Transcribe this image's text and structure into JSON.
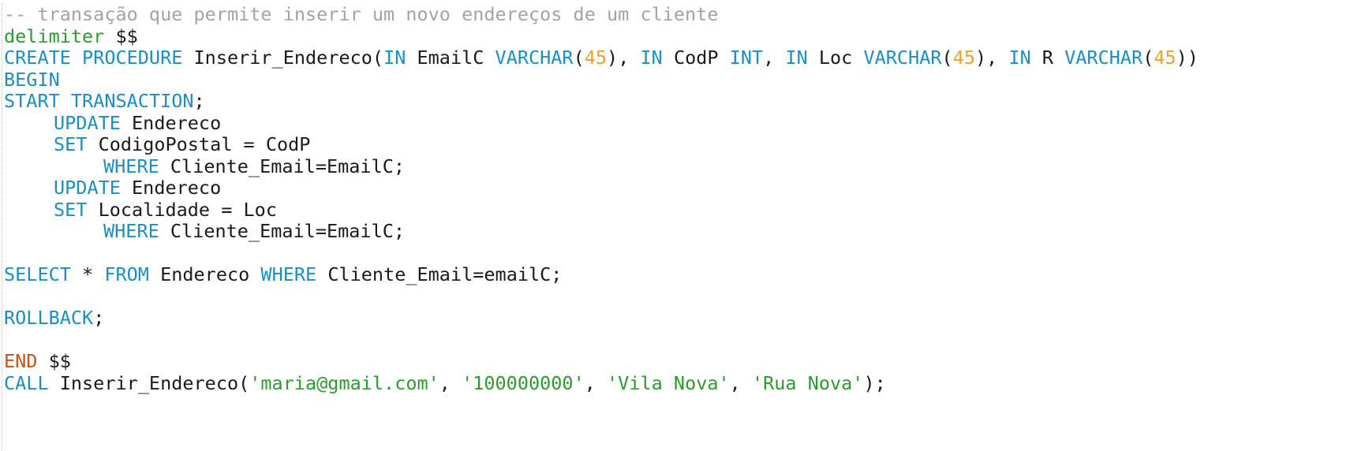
{
  "editor": {
    "lines": [
      [
        {
          "t": "-- transação que permite inserir um novo endereços de um cliente",
          "c": "comment"
        }
      ],
      [
        {
          "t": "delimiter",
          "c": "delim"
        },
        {
          "t": " $$",
          "c": "plain"
        }
      ],
      [
        {
          "t": "CREATE",
          "c": "kw"
        },
        {
          "t": " ",
          "c": "plain"
        },
        {
          "t": "PROCEDURE",
          "c": "kw"
        },
        {
          "t": " Inserir_Endereco(",
          "c": "plain"
        },
        {
          "t": "IN",
          "c": "kw"
        },
        {
          "t": " EmailC ",
          "c": "plain"
        },
        {
          "t": "VARCHAR",
          "c": "kw"
        },
        {
          "t": "(",
          "c": "plain"
        },
        {
          "t": "45",
          "c": "num"
        },
        {
          "t": "), ",
          "c": "plain"
        },
        {
          "t": "IN",
          "c": "kw"
        },
        {
          "t": " CodP ",
          "c": "plain"
        },
        {
          "t": "INT",
          "c": "kw"
        },
        {
          "t": ", ",
          "c": "plain"
        },
        {
          "t": "IN",
          "c": "kw"
        },
        {
          "t": " Loc ",
          "c": "plain"
        },
        {
          "t": "VARCHAR",
          "c": "kw"
        },
        {
          "t": "(",
          "c": "plain"
        },
        {
          "t": "45",
          "c": "num"
        },
        {
          "t": "), ",
          "c": "plain"
        },
        {
          "t": "IN",
          "c": "kw"
        },
        {
          "t": " R ",
          "c": "plain"
        },
        {
          "t": "VARCHAR",
          "c": "kw"
        },
        {
          "t": "(",
          "c": "plain"
        },
        {
          "t": "45",
          "c": "num"
        },
        {
          "t": "))",
          "c": "plain"
        }
      ],
      [
        {
          "t": "BEGIN",
          "c": "kw"
        }
      ],
      [
        {
          "t": "START",
          "c": "kw"
        },
        {
          "t": " ",
          "c": "plain"
        },
        {
          "t": "TRANSACTION",
          "c": "kw"
        },
        {
          "t": ";",
          "c": "plain"
        }
      ],
      [
        {
          "t": "UPDATE",
          "c": "kw",
          "indent": 1
        },
        {
          "t": " Endereco",
          "c": "plain"
        }
      ],
      [
        {
          "t": "SET",
          "c": "kw",
          "indent": 1
        },
        {
          "t": " CodigoPostal = CodP",
          "c": "plain"
        }
      ],
      [
        {
          "t": "WHERE",
          "c": "kw",
          "indent": 2
        },
        {
          "t": " Cliente_Email=EmailC;",
          "c": "plain"
        }
      ],
      [
        {
          "t": "UPDATE",
          "c": "kw",
          "indent": 1
        },
        {
          "t": " Endereco",
          "c": "plain"
        }
      ],
      [
        {
          "t": "SET",
          "c": "kw",
          "indent": 1
        },
        {
          "t": " Localidade = Loc",
          "c": "plain"
        }
      ],
      [
        {
          "t": "WHERE",
          "c": "kw",
          "indent": 2
        },
        {
          "t": " Cliente_Email=EmailC;",
          "c": "plain"
        }
      ],
      [],
      [
        {
          "t": "SELECT",
          "c": "kw"
        },
        {
          "t": " * ",
          "c": "plain"
        },
        {
          "t": "FROM",
          "c": "kw"
        },
        {
          "t": " Endereco ",
          "c": "plain"
        },
        {
          "t": "WHERE",
          "c": "kw"
        },
        {
          "t": " Cliente_Email=emailC;",
          "c": "plain"
        }
      ],
      [],
      [
        {
          "t": "ROLLBACK",
          "c": "kw"
        },
        {
          "t": ";",
          "c": "plain"
        }
      ],
      [],
      [
        {
          "t": "END",
          "c": "end"
        },
        {
          "t": " $$",
          "c": "plain"
        }
      ],
      [
        {
          "t": "CALL",
          "c": "kw"
        },
        {
          "t": " Inserir_Endereco(",
          "c": "plain"
        },
        {
          "t": "'maria@gmail.com'",
          "c": "str"
        },
        {
          "t": ", ",
          "c": "plain"
        },
        {
          "t": "'100000000'",
          "c": "str"
        },
        {
          "t": ", ",
          "c": "plain"
        },
        {
          "t": "'Vila Nova'",
          "c": "str"
        },
        {
          "t": ", ",
          "c": "plain"
        },
        {
          "t": "'Rua Nova'",
          "c": "str"
        },
        {
          "t": ");",
          "c": "plain"
        }
      ]
    ]
  },
  "colors": {
    "comment": "#a3a3a3",
    "keyword": "#1b8ec2",
    "delimiter": "#2e9a2e",
    "number": "#f0a030",
    "string": "#2e9a2e",
    "end_keyword": "#c8501c",
    "text": "#1a1a1a",
    "background": "#ffffff"
  }
}
